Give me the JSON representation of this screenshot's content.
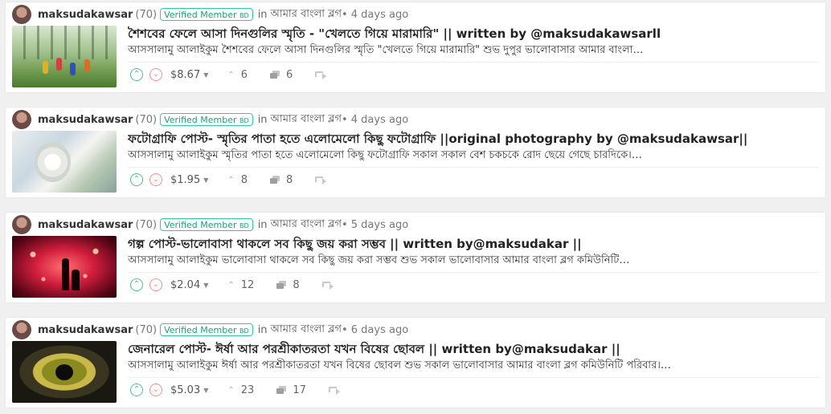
{
  "posts": [
    {
      "author": "maksudakawsar",
      "reputation": "(70)",
      "badge_text": "Verified Member",
      "badge_tag": "BD",
      "in_word": "in",
      "community": "আমার বাংলা ব্লগ",
      "time_text": "• 4 days ago",
      "title": "শৈশবের ফেলে আসা দিনগুলির স্মৃতি - \"খেলতে গিয়ে মারামারি\" || written by @maksudakawsarll",
      "excerpt": "আসসালামু আলাইকুম শৈশবের ফেলে আসা দিনগুলির স্মৃতি \"খেলতে গিয়ে মারামারি\" শুভ দুপুর ভালোবাসার আমার বাংলা…",
      "payout": "$8.67",
      "votes": "6",
      "comments": "6"
    },
    {
      "author": "maksudakawsar",
      "reputation": "(70)",
      "badge_text": "Verified Member",
      "badge_tag": "BD",
      "in_word": "in",
      "community": "আমার বাংলা ব্লগ",
      "time_text": "• 4 days ago",
      "title": "ফটোগ্রাফি পোস্ট- স্মৃতির পাতা হতে এলোমেলো কিছু ফটোগ্রাফি ||original photography by @maksudakawsar||",
      "excerpt": "আসসালামু আলাইকুম স্মৃতির পাতা হতে এলোমেলো কিছু ফটোগ্রাফি সকাল সকাল বেশ চকচকে রোদ ছেয়ে গেছে চারদিকে।…",
      "payout": "$1.95",
      "votes": "8",
      "comments": "8"
    },
    {
      "author": "maksudakawsar",
      "reputation": "(70)",
      "badge_text": "Verified Member",
      "badge_tag": "BD",
      "in_word": "in",
      "community": "আমার বাংলা ব্লগ",
      "time_text": "• 5 days ago",
      "title": "গল্প পোস্ট-ভালোবাসা থাকলে সব কিছু জয় করা সম্ভব || written by@maksudakar ||",
      "excerpt": "আসসালামু আলাইকুম ভালোবাসা থাকলে সব কিছু জয় করা সম্ভব শুভ সকাল ভালোবাসার আমার বাংলা ব্লগ কমিউনিটি…",
      "payout": "$2.04",
      "votes": "12",
      "comments": "8"
    },
    {
      "author": "maksudakawsar",
      "reputation": "(70)",
      "badge_text": "Verified Member",
      "badge_tag": "BD",
      "in_word": "in",
      "community": "আমার বাংলা ব্লগ",
      "time_text": "• 6 days ago",
      "title": "জেনারেল পোস্ট- ঈর্ষা আর পরশ্রীকাতরতা যখন বিষের ছোবল || written by@maksudakar ||",
      "excerpt": "আসসালামু আলাইকুম ঈর্ষা আর পরশ্রীকাতরতা যখন বিষের ছোবল শুভ সকাল ভালোবাসার আমার বাংলা ব্লগ কমিউনিটি পরিবার।…",
      "payout": "$5.03",
      "votes": "23",
      "comments": "17"
    }
  ],
  "icons": {
    "upvote": "chevron-up-icon",
    "downvote": "chevron-down-icon",
    "votes": "votes-icon",
    "comments": "comments-icon",
    "reblog": "reblog-icon"
  },
  "colors": {
    "badge_accent": "#2ecc9a",
    "upvote": "#4bc08b",
    "downvote": "#f28c8c"
  }
}
